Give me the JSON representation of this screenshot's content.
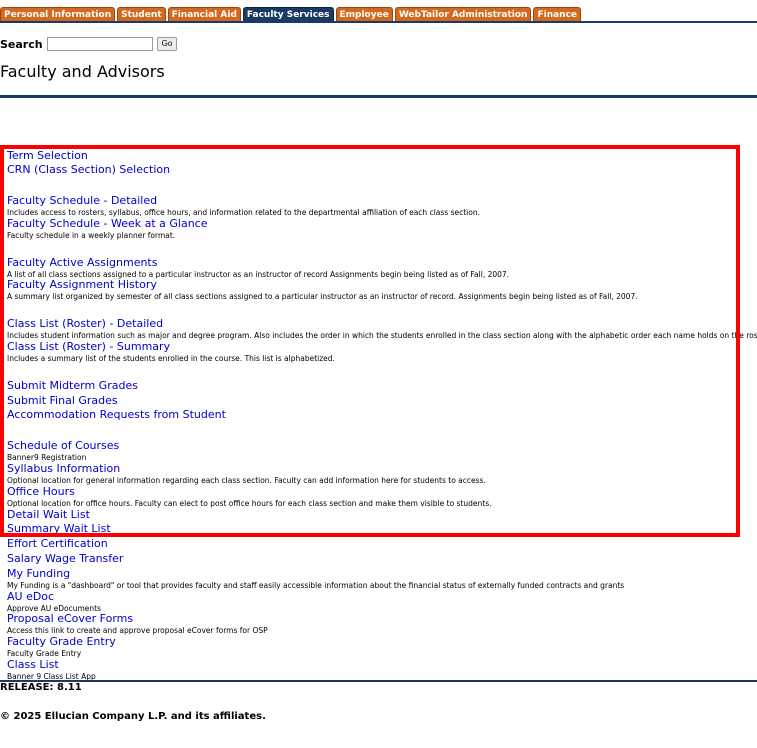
{
  "tabs": [
    {
      "label": "Personal Information",
      "active": false
    },
    {
      "label": "Student",
      "active": false
    },
    {
      "label": "Financial Aid",
      "active": false
    },
    {
      "label": "Faculty Services",
      "active": true
    },
    {
      "label": "Employee",
      "active": false
    },
    {
      "label": "WebTailor Administration",
      "active": false
    },
    {
      "label": "Finance",
      "active": false
    }
  ],
  "search": {
    "label": "Search",
    "value": "",
    "go_label": "Go"
  },
  "page_title": "Faculty and Advisors",
  "menu": [
    {
      "label": "Term Selection",
      "desc": ""
    },
    {
      "label": "CRN (Class Section) Selection",
      "desc": ""
    },
    {
      "label": "Faculty Schedule - Detailed",
      "desc": "Includes access to rosters, syllabus, office hours, and information related to the departmental affiliation of each class section."
    },
    {
      "label": "Faculty Schedule - Week at a Glance",
      "desc": "Faculty schedule in a weekly planner format."
    },
    {
      "label": "Faculty Active Assignments",
      "desc": "A list of all class sections assigned to a particular instructor as an instructor of record Assignments begin being listed as of Fall, 2007."
    },
    {
      "label": "Faculty Assignment History",
      "desc": "A summary list organized by semester of all class sections assigned to a particular instructor as an instructor of record. Assignments begin being listed as of Fall, 2007."
    },
    {
      "label": "Class List (Roster) - Detailed",
      "desc": "Includes student information such as major and degree program. Also includes the order in which the students enrolled in the class section along with the alphabetic order each name holds on the roster."
    },
    {
      "label": "Class List (Roster) - Summary",
      "desc": "Includes a summary list of the students enrolled in the course. This list is alphabetized."
    },
    {
      "label": "Submit Midterm Grades",
      "desc": ""
    },
    {
      "label": "Submit Final Grades",
      "desc": ""
    },
    {
      "label": "Accommodation Requests from Student",
      "desc": ""
    },
    {
      "label": "Schedule of Courses",
      "desc": "Banner9 Registration"
    },
    {
      "label": "Syllabus Information",
      "desc": "Optional location for general information regarding each class section. Faculty can add information here for students to access."
    },
    {
      "label": "Office Hours",
      "desc": "Optional location for office hours. Faculty can elect to post office hours for each class section and make them visible to students."
    },
    {
      "label": "Detail Wait List",
      "desc": ""
    },
    {
      "label": "Summary Wait List",
      "desc": ""
    },
    {
      "label": "Effort Certification",
      "desc": ""
    },
    {
      "label": "Salary Wage Transfer",
      "desc": ""
    },
    {
      "label": "My Funding",
      "desc": "My Funding is a \"dashboard\" or tool that provides faculty and staff easily accessible information about the financial status of externally funded contracts and grants"
    },
    {
      "label": "AU eDoc",
      "desc": "Approve AU eDocuments"
    },
    {
      "label": "Proposal eCover Forms",
      "desc": "Access this link to create and approve proposal eCover forms for OSP"
    },
    {
      "label": "Faculty Grade Entry",
      "desc": "Faculty Grade Entry"
    },
    {
      "label": "Class List",
      "desc": "Banner 9 Class List App"
    }
  ],
  "release": "RELEASE: 8.11",
  "copyright": "© 2025 Ellucian Company L.P. and its affiliates.",
  "colors": {
    "tab": "#d2691e",
    "tab_active": "#1a3a66",
    "link": "#0000cc",
    "highlight": "#ff0000"
  }
}
